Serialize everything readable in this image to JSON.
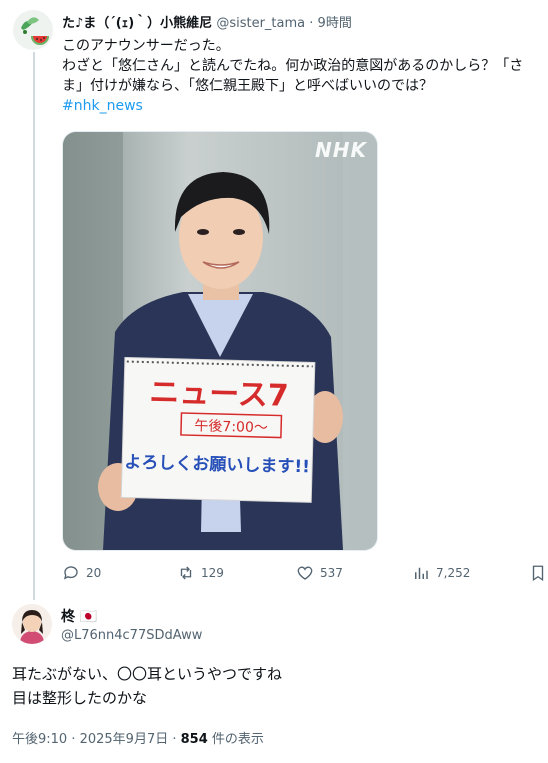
{
  "tweet": {
    "author_name": "た♪ま（´(ｪ)｀）小熊維尼",
    "handle": "@sister_tama",
    "time_sep": "·",
    "time": "9時間",
    "text_lines": [
      "このアナウンサーだった。",
      "わざと「悠仁さん」と読んでたね。何か政治的意図があるのかしら？「さ",
      "ま」付けが嫌なら、「悠仁親王殿下」と呼べばいいのでは？"
    ],
    "hashtag": "#nhk_news",
    "media": {
      "watermark": "NHK",
      "sign_title": "ニュース7",
      "sign_time": "午後7:00〜",
      "sign_message": "よろしくお願いします!!"
    },
    "actions": {
      "replies": "20",
      "retweets": "129",
      "likes": "537",
      "views": "7,252"
    }
  },
  "reply": {
    "author_name": "柊",
    "flag": "🇯🇵",
    "handle": "@L76nn4c77SDdAww",
    "text_lines": [
      "耳たぶがない、〇〇耳というやつですね",
      "目は整形したのかな"
    ],
    "timestamp": "午後9:10 · 2025年9月7日 · ",
    "view_count": "854",
    "view_suffix": " 件の表示"
  },
  "colors": {
    "accent": "#1d9bf0",
    "muted": "#536471",
    "text": "#0f1419"
  }
}
